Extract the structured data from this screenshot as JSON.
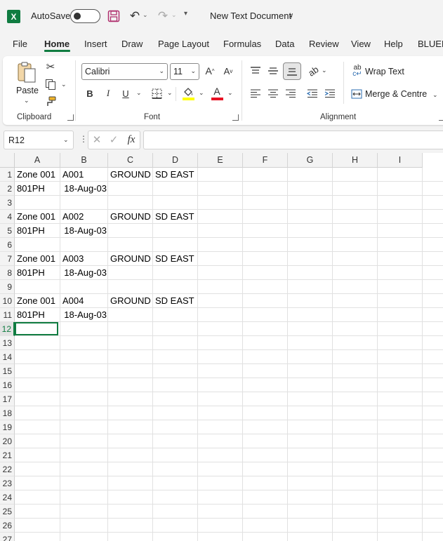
{
  "titlebar": {
    "app_letter": "X",
    "autosave_label": "AutoSave",
    "doc_title": "New Text Document"
  },
  "tabs": [
    "File",
    "Home",
    "Insert",
    "Draw",
    "Page Layout",
    "Formulas",
    "Data",
    "Review",
    "View",
    "Help",
    "BLUEB"
  ],
  "active_tab": "Home",
  "ribbon": {
    "paste_label": "Paste",
    "clipboard_label": "Clipboard",
    "font_label": "Font",
    "alignment_label": "Alignment",
    "font_name": "Calibri",
    "font_size": "11",
    "wrap_text": "Wrap Text",
    "merge_centre": "Merge & Centre",
    "bold": "B",
    "italic": "I",
    "underline": "U",
    "font_color": "#e81123",
    "highlight_color": "#ffff00"
  },
  "formula_bar": {
    "name_box": "R12",
    "fx": "fx",
    "formula": ""
  },
  "grid": {
    "columns": [
      "A",
      "B",
      "C",
      "D",
      "E",
      "F",
      "G",
      "H",
      "I"
    ],
    "rows": [
      "1",
      "2",
      "3",
      "4",
      "5",
      "6",
      "7",
      "8",
      "9",
      "10",
      "11",
      "12",
      "13",
      "14",
      "15",
      "16",
      "17",
      "18",
      "19",
      "20",
      "21",
      "22",
      "23",
      "24",
      "25",
      "26",
      "27"
    ],
    "selected_row": "12",
    "cells": [
      {
        "ref": "A1",
        "text": "Zone 001"
      },
      {
        "ref": "B1",
        "text": "A001"
      },
      {
        "ref": "C1",
        "text": "GROUND F"
      },
      {
        "ref": "D1",
        "text": "SD EAST"
      },
      {
        "ref": "A2",
        "text": "801PH"
      },
      {
        "ref": "B2",
        "text": "18-Aug-03"
      },
      {
        "ref": "A4",
        "text": "Zone 001"
      },
      {
        "ref": "B4",
        "text": "A002"
      },
      {
        "ref": "C4",
        "text": "GROUND F"
      },
      {
        "ref": "D4",
        "text": "SD EAST"
      },
      {
        "ref": "A5",
        "text": "801PH"
      },
      {
        "ref": "B5",
        "text": "18-Aug-03"
      },
      {
        "ref": "A7",
        "text": "Zone 001"
      },
      {
        "ref": "B7",
        "text": "A003"
      },
      {
        "ref": "C7",
        "text": "GROUND F"
      },
      {
        "ref": "D7",
        "text": "SD EAST"
      },
      {
        "ref": "A8",
        "text": "801PH"
      },
      {
        "ref": "B8",
        "text": "18-Aug-03"
      },
      {
        "ref": "A10",
        "text": "Zone 001"
      },
      {
        "ref": "B10",
        "text": "A004"
      },
      {
        "ref": "C10",
        "text": "GROUND F"
      },
      {
        "ref": "D10",
        "text": "SD EAST"
      },
      {
        "ref": "A11",
        "text": "801PH"
      },
      {
        "ref": "B11",
        "text": "18-Aug-03"
      }
    ]
  }
}
